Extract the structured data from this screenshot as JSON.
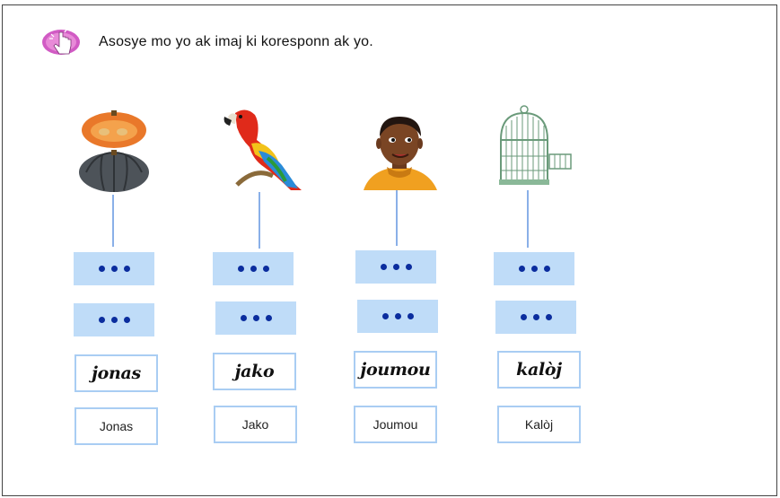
{
  "instruction": "Asosye mo yo ak imaj ki koresponn ak yo.",
  "icons": {
    "header": "hand-pointer-icon"
  },
  "columns": [
    {
      "image": "pumpkin-image",
      "cursive": "jonas",
      "print": "Jonas"
    },
    {
      "image": "parrot-image",
      "cursive": "jako",
      "print": "Jako"
    },
    {
      "image": "boy-image",
      "cursive": "joumou",
      "print": "Joumou"
    },
    {
      "image": "birdcage-image",
      "cursive": "kalòj",
      "print": "Kalòj"
    }
  ],
  "colors": {
    "dot_box": "#bfdcf8",
    "dot": "#0b2d9e",
    "word_border": "#a9cdf3",
    "connector": "#8ab0e8"
  }
}
